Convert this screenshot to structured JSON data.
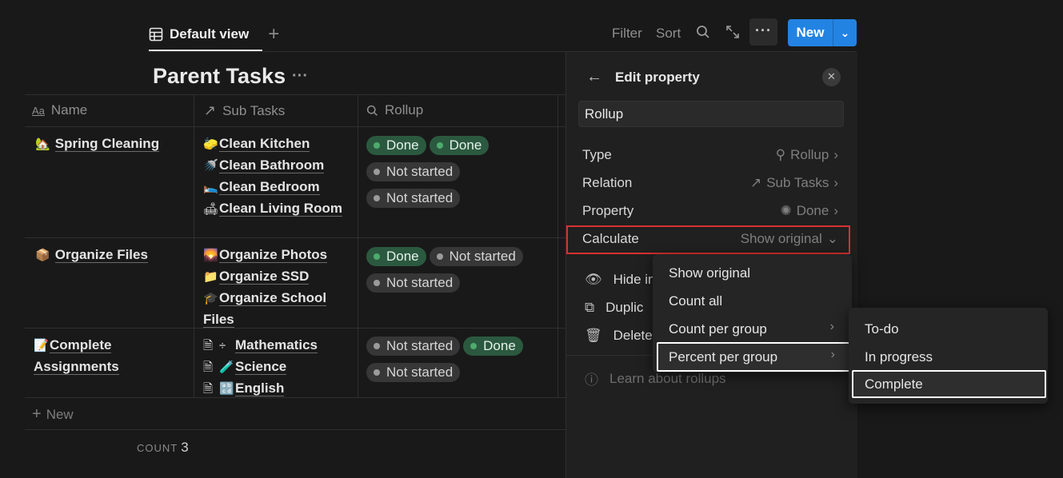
{
  "header": {
    "view_label": "Default view",
    "toolbar": {
      "filter": "Filter",
      "sort": "Sort",
      "new": "New"
    }
  },
  "page": {
    "title": "Parent Tasks"
  },
  "table": {
    "columns": [
      "Name",
      "Sub Tasks",
      "Rollup"
    ],
    "rows": [
      {
        "name": "Spring Cleaning",
        "name_icon": "house-with-garden-emoji",
        "sub_tasks": [
          {
            "icon": "sponge-emoji",
            "label": "Clean Kitchen"
          },
          {
            "icon": "shower-emoji",
            "label": "Clean Bathroom"
          },
          {
            "icon": "bed-emoji",
            "label": "Clean Bedroom"
          },
          {
            "icon": "couch-emoji",
            "label": "Clean Living Room"
          }
        ],
        "rollup": [
          [
            "Done",
            "Done"
          ],
          [
            "Not started"
          ],
          [
            "Not started"
          ]
        ]
      },
      {
        "name": "Organize Files",
        "name_icon": "package-emoji",
        "sub_tasks": [
          {
            "icon": "photo-emoji",
            "label": "Organize Photos"
          },
          {
            "icon": "folder-emoji",
            "label": "Organize SSD"
          },
          {
            "icon": "grad-cap-emoji",
            "label": "Organize School Files"
          }
        ],
        "rollup": [
          [
            "Done",
            "Not started"
          ],
          [
            "Not started"
          ]
        ]
      },
      {
        "name": "Complete Assignments",
        "name_icon": "memo-emoji",
        "sub_tasks": [
          {
            "icon": "divide-emoji",
            "label": "Mathematics"
          },
          {
            "icon": "test-tube-emoji",
            "label": "Science"
          },
          {
            "icon": "abc-emoji",
            "label": "English"
          }
        ],
        "rollup": [
          [
            "Not started",
            "Done"
          ],
          [
            "Not started"
          ]
        ]
      }
    ],
    "new_row": "New",
    "count_label": "COUNT",
    "count_value": "3"
  },
  "panel": {
    "title": "Edit property",
    "name_value": "Rollup",
    "rows": {
      "type": {
        "label": "Type",
        "value": "Rollup"
      },
      "relation": {
        "label": "Relation",
        "value": "Sub Tasks"
      },
      "property": {
        "label": "Property",
        "value": "Done"
      },
      "calculate": {
        "label": "Calculate",
        "value": "Show original"
      }
    },
    "actions": [
      "Hide in",
      "Duplic",
      "Delete"
    ],
    "learn": "Learn about rollups"
  },
  "calc_menu": {
    "items": [
      "Show original",
      "Count all",
      "Count per group",
      "Percent per group"
    ]
  },
  "group_menu": {
    "items": [
      "To-do",
      "In progress",
      "Complete"
    ]
  },
  "colors": {
    "accent": "#2383e2",
    "done_bg": "#2b593f",
    "highlight_red": "#d9302f"
  }
}
